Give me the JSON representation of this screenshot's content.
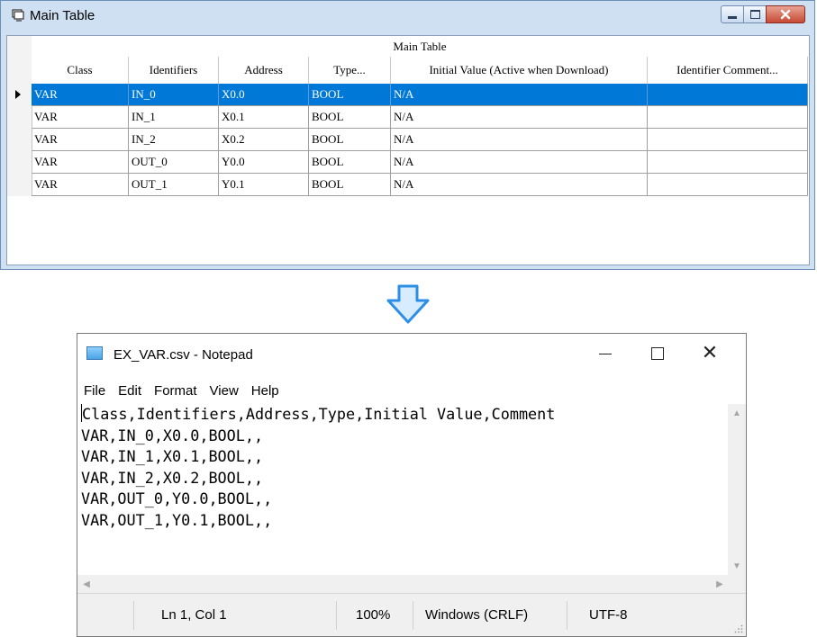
{
  "main_table_window": {
    "title": "Main Table",
    "caption": "Main Table",
    "columns": [
      "Class",
      "Identifiers",
      "Address",
      "Type...",
      "Initial Value (Active when Download)",
      "Identifier Comment..."
    ],
    "rows": [
      {
        "class": "VAR",
        "identifier": "IN_0",
        "address": "X0.0",
        "type": "BOOL",
        "initial": "N/A",
        "comment": "",
        "selected": true
      },
      {
        "class": "VAR",
        "identifier": "IN_1",
        "address": "X0.1",
        "type": "BOOL",
        "initial": "N/A",
        "comment": "",
        "selected": false
      },
      {
        "class": "VAR",
        "identifier": "IN_2",
        "address": "X0.2",
        "type": "BOOL",
        "initial": "N/A",
        "comment": "",
        "selected": false
      },
      {
        "class": "VAR",
        "identifier": "OUT_0",
        "address": "Y0.0",
        "type": "BOOL",
        "initial": "N/A",
        "comment": "",
        "selected": false
      },
      {
        "class": "VAR",
        "identifier": "OUT_1",
        "address": "Y0.1",
        "type": "BOOL",
        "initial": "N/A",
        "comment": "",
        "selected": false
      }
    ]
  },
  "notepad": {
    "title": "EX_VAR.csv - Notepad",
    "menu": [
      "File",
      "Edit",
      "Format",
      "View",
      "Help"
    ],
    "lines": [
      "Class,Identifiers,Address,Type,Initial Value,Comment",
      "VAR,IN_0,X0.0,BOOL,,",
      "VAR,IN_1,X0.1,BOOL,,",
      "VAR,IN_2,X0.2,BOOL,,",
      "VAR,OUT_0,Y0.0,BOOL,,",
      "VAR,OUT_1,Y0.1,BOOL,,"
    ],
    "status": {
      "position": "Ln 1, Col 1",
      "zoom": "100%",
      "line_ending": "Windows (CRLF)",
      "encoding": "UTF-8"
    }
  },
  "colors": {
    "selection": "#0078d7",
    "arrow_fill": "#d7ecff",
    "arrow_stroke": "#2d8ee6"
  },
  "icons": [
    "table-window-icon",
    "minimize-icon",
    "maximize-icon",
    "close-icon",
    "down-arrow-icon",
    "notepad-icon",
    "row-indicator-icon",
    "scroll-up-icon",
    "scroll-down-icon",
    "scroll-left-icon",
    "scroll-right-icon",
    "resize-grip-icon"
  ]
}
